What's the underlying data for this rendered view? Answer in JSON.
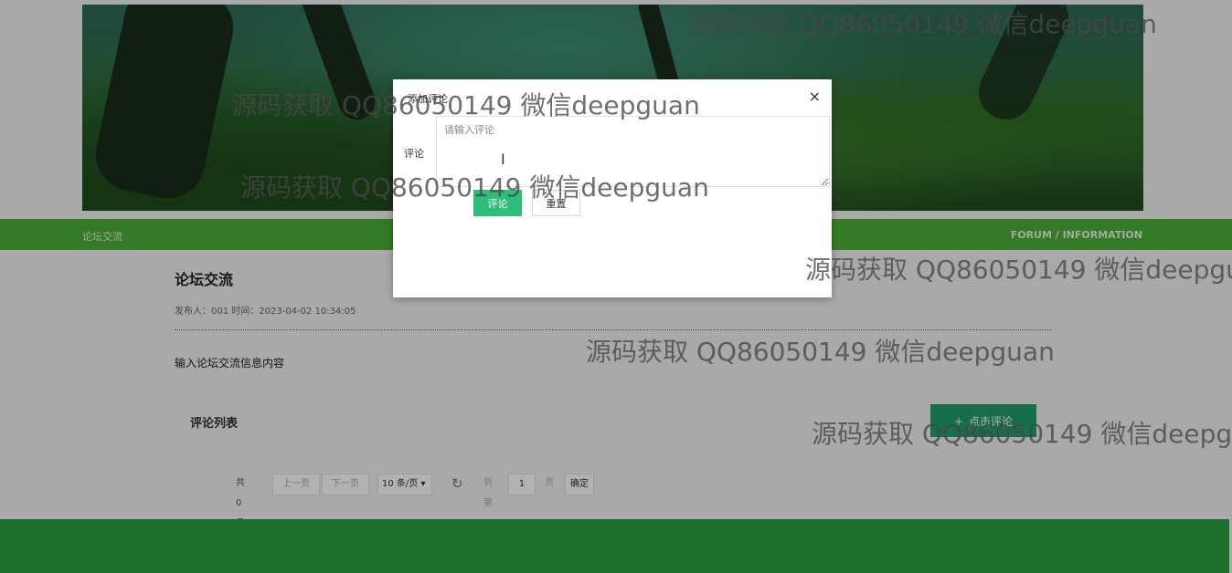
{
  "nav": {
    "left_label": "论坛交流",
    "right_label": "FORUM / INFORMATION"
  },
  "article": {
    "title": "论坛交流",
    "meta": "发布人：001 时间：2023-04-02 10:34:05",
    "content": "输入论坛交流信息内容"
  },
  "comments": {
    "heading": "评论列表",
    "add_button": "点击评论",
    "add_icon": "plus-icon"
  },
  "pagination": {
    "total": "共 0 条",
    "prev": "上一页",
    "next": "下一页",
    "page_size": "10 条/页",
    "goto_label": "到第",
    "page_value": "1",
    "page_unit": "页",
    "confirm": "确定",
    "refresh_icon": "refresh-icon"
  },
  "modal": {
    "title": "添加评论",
    "form_label": "评论",
    "placeholder": "请输入评论",
    "submit": "评论",
    "reset": "重置",
    "close_icon": "close-icon"
  },
  "watermark": {
    "text": "源码获取 QQ86050149 微信deepguan"
  },
  "colors": {
    "nav_green": "#4caf37",
    "footer_green": "#2aa33f",
    "accent": "#2fbe7a"
  }
}
